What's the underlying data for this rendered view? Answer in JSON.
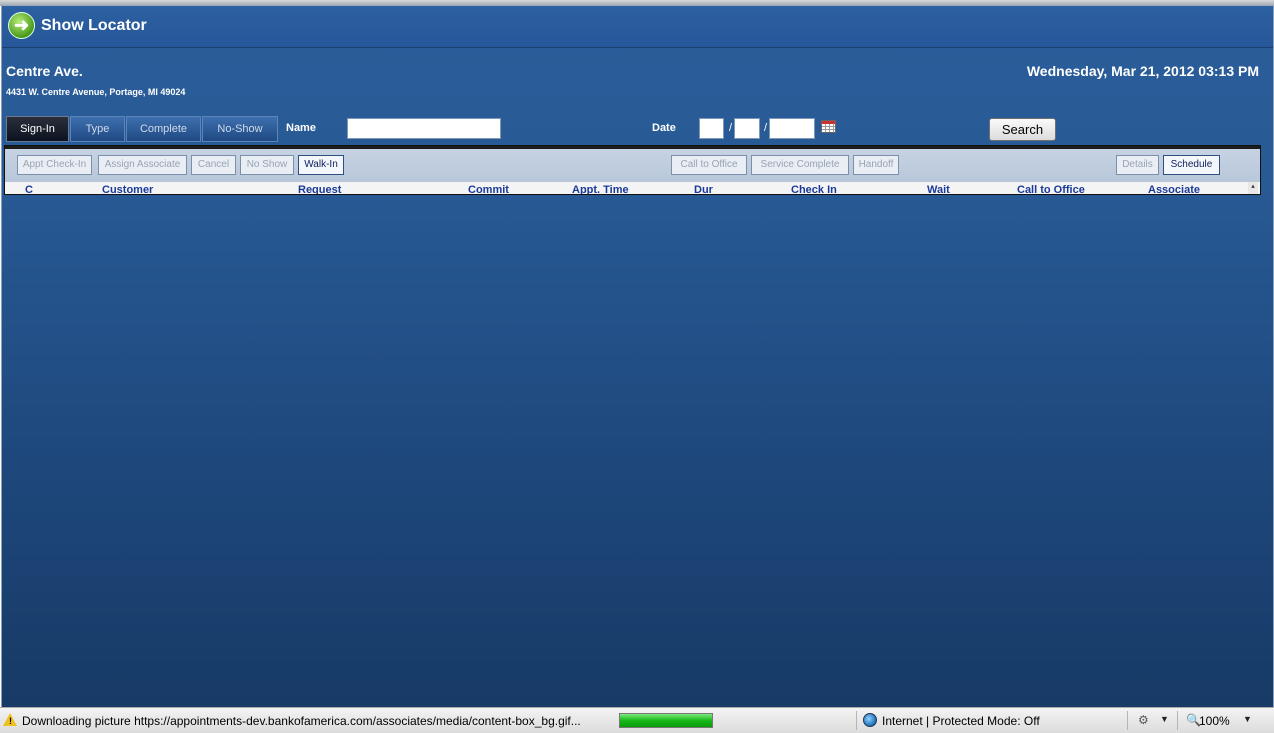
{
  "app": {
    "title": "Show Locator",
    "logo_icon": "arrow-right-circle-icon",
    "store_name": "Centre Ave.",
    "store_address": "4431 W. Centre Avenue, Portage, MI 49024",
    "datetime": "Wednesday, Mar 21, 2012 03:13 PM"
  },
  "tabs": [
    {
      "label": "Sign-In",
      "active": true
    },
    {
      "label": "Type",
      "active": false
    },
    {
      "label": "Complete",
      "active": false
    },
    {
      "label": "No-Show",
      "active": false
    }
  ],
  "search": {
    "name_label": "Name",
    "name_value": "",
    "date_label": "Date",
    "date_month": "",
    "date_day": "",
    "date_year": "",
    "date_separator": "/",
    "calendar_icon": "calendar-icon",
    "button_label": "Search"
  },
  "toolbar": {
    "appt_checkin": "Appt Check-In",
    "assign_associate": "Assign Associate",
    "cancel": "Cancel",
    "no_show": "No Show",
    "walk_in": "Walk-In",
    "call_to_office": "Call to Office",
    "service_complete": "Service Complete",
    "handoff": "Handoff",
    "details": "Details",
    "schedule": "Schedule"
  },
  "table": {
    "columns": [
      "C",
      "Customer",
      "Request",
      "Commit",
      "Appt. Time",
      "Dur",
      "Check In",
      "Wait",
      "Call to Office",
      "Associate"
    ]
  },
  "statusbar": {
    "warning_icon": "warning-icon",
    "text": "Downloading picture https://appointments-dev.bankofamerica.com/associates/media/content-box_bg.gif...",
    "progress": 1.0,
    "zone_icon": "globe-icon",
    "zone_text": "Internet | Protected Mode: Off",
    "zoom": "100%"
  },
  "colors": {
    "app_background": "#285a95",
    "header_text": "#1a3a9a",
    "progress_green": "#18b818"
  }
}
